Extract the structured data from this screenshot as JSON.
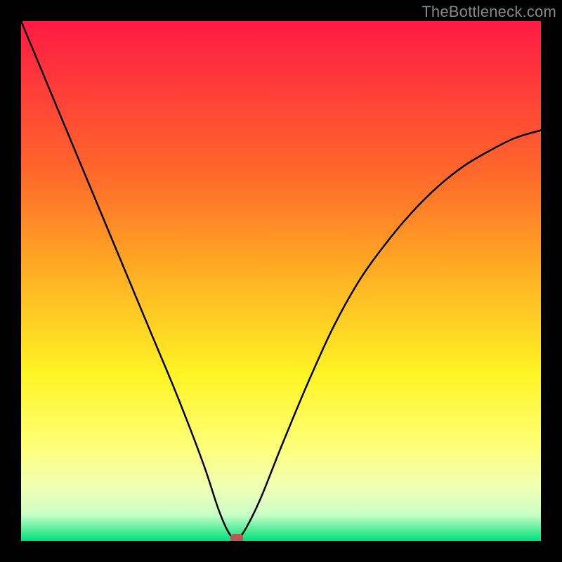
{
  "watermark": "TheBottleneck.com",
  "chart_data": {
    "type": "line",
    "title": "",
    "xlabel": "",
    "ylabel": "",
    "xlim": [
      0,
      100
    ],
    "ylim": [
      0,
      100
    ],
    "gradient_stops": [
      {
        "offset": 0.0,
        "color": "#ff1a44"
      },
      {
        "offset": 0.12,
        "color": "#ff3a3a"
      },
      {
        "offset": 0.3,
        "color": "#ff6a2a"
      },
      {
        "offset": 0.5,
        "color": "#ffb423"
      },
      {
        "offset": 0.68,
        "color": "#fff425"
      },
      {
        "offset": 0.82,
        "color": "#fdff7a"
      },
      {
        "offset": 0.9,
        "color": "#f0ffb8"
      },
      {
        "offset": 0.95,
        "color": "#c8ffc8"
      },
      {
        "offset": 1.0,
        "color": "#00e07a"
      }
    ],
    "series": [
      {
        "name": "bottleneck-curve",
        "x": [
          0,
          5,
          10,
          15,
          20,
          25,
          30,
          35,
          38,
          40,
          41.5,
          43,
          46,
          50,
          55,
          60,
          65,
          70,
          75,
          80,
          85,
          90,
          95,
          100
        ],
        "y": [
          100,
          88,
          76,
          64,
          52,
          40,
          28,
          15,
          6,
          1.5,
          0.5,
          2,
          8,
          18,
          30,
          41,
          50,
          57,
          63,
          68,
          72,
          75,
          77.5,
          79
        ]
      }
    ],
    "marker": {
      "x": 41.5,
      "y": 0.5,
      "color": "#b85a52"
    }
  }
}
